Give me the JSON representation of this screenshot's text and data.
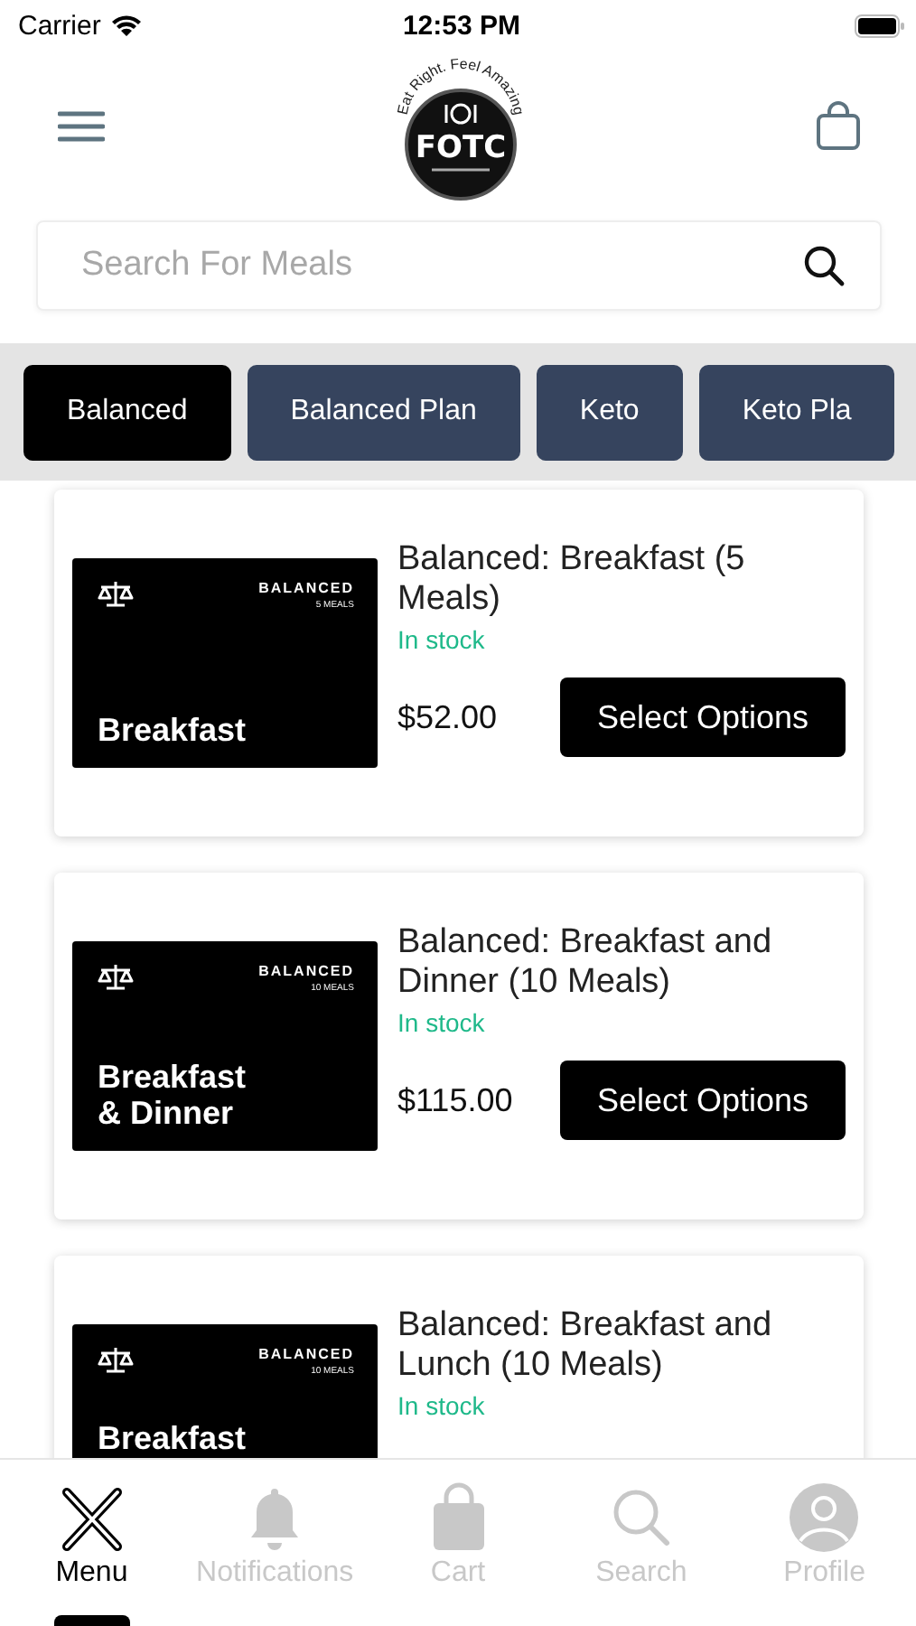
{
  "status_bar": {
    "carrier": "Carrier",
    "time": "12:53 PM"
  },
  "header": {
    "logo": {
      "tagline": "Eat Right. Feel Amazing",
      "name": "FOTC"
    }
  },
  "search": {
    "placeholder": "Search For Meals"
  },
  "categories": [
    {
      "label": "Balanced",
      "selected": true
    },
    {
      "label": "Balanced Plan",
      "selected": false
    },
    {
      "label": "Keto",
      "selected": false
    },
    {
      "label": "Keto Pla",
      "selected": false
    }
  ],
  "products": [
    {
      "image": {
        "brand": "BALANCED",
        "meals": "5 MEALS",
        "title": "Breakfast"
      },
      "name": "Balanced: Breakfast (5 Meals)",
      "stock": "In stock",
      "price": "$52.00",
      "button": "Select Options"
    },
    {
      "image": {
        "brand": "BALANCED",
        "meals": "10 MEALS",
        "title": "Breakfast\n& Dinner"
      },
      "name": "Balanced: Breakfast and Dinner (10 Meals)",
      "stock": "In stock",
      "price": "$115.00",
      "button": "Select Options"
    },
    {
      "image": {
        "brand": "BALANCED",
        "meals": "10 MEALS",
        "title": "Breakfast"
      },
      "name": "Balanced: Breakfast and Lunch (10 Meals)",
      "stock": "In stock"
    }
  ],
  "tab_bar": [
    {
      "kind": "menu",
      "label": "Menu",
      "selected": true
    },
    {
      "kind": "bell",
      "label": "Notifications",
      "selected": false
    },
    {
      "kind": "cart",
      "label": "Cart",
      "selected": false
    },
    {
      "kind": "search",
      "label": "Search",
      "selected": false
    },
    {
      "kind": "profile",
      "label": "Profile",
      "selected": false
    }
  ]
}
